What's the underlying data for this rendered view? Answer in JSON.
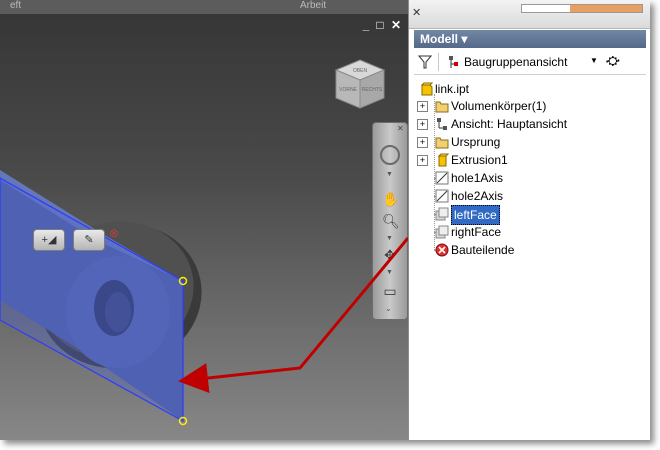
{
  "viewport": {
    "top_strip_text": [
      "eft",
      "Arbeit"
    ],
    "window_buttons": [
      "_",
      "□",
      "✕"
    ],
    "viewcube_labels": [
      "OBEN",
      "VORNE",
      "RECHTS"
    ],
    "mini_toolbar": [
      "+◢",
      "✎",
      "⊗"
    ],
    "nav_icons": [
      "steering-wheel-icon",
      "pan-icon",
      "zoom-icon",
      "orbit-icon",
      "look-at-icon"
    ]
  },
  "panel": {
    "title": "Modell ▾",
    "close_button": "✕",
    "toolbar": {
      "filter_icon": "filter-icon",
      "view_label": "Baugruppenansicht",
      "dropdown_arrow": "▼",
      "search_icon": "binoculars-icon"
    },
    "tree": [
      {
        "label": "link.ipt",
        "icon": "part-icon",
        "expander": ""
      },
      {
        "label": "Volumenkörper(1)",
        "icon": "folder-icon",
        "expander": "+"
      },
      {
        "label": "Ansicht: Hauptansicht",
        "icon": "view-icon",
        "expander": "+"
      },
      {
        "label": "Ursprung",
        "icon": "folder-icon",
        "expander": "+"
      },
      {
        "label": "Extrusion1",
        "icon": "extrusion-icon",
        "expander": "+"
      },
      {
        "label": "hole1Axis",
        "icon": "axis-icon",
        "expander": ""
      },
      {
        "label": "hole2Axis",
        "icon": "axis-icon",
        "expander": ""
      },
      {
        "label": "leftFace",
        "icon": "face-icon",
        "expander": ""
      },
      {
        "label": "rightFace",
        "icon": "face-icon",
        "expander": ""
      },
      {
        "label": "Bauteilende",
        "icon": "end-of-part-icon",
        "expander": ""
      }
    ]
  },
  "colors": {
    "selection": "#316ac5",
    "annotation_arrow": "#c00000",
    "selected_face": "#4a5ec8"
  }
}
